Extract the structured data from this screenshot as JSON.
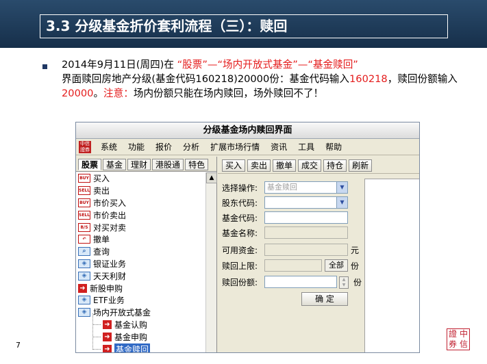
{
  "slide": {
    "title": "3.3 分级基金折价套利流程（三）：赎回",
    "page_number": "7",
    "text": {
      "part1": "2014年9月11日(周四)在 ",
      "red1": "“股票”—“场内开放式基金”—“基金赎回”",
      "part2": "界面赎回房地产分级(基金代码160218)20000份：基金代码输入",
      "red2": "160218",
      "part3": "，赎回份额输入",
      "red3": "20000",
      "part4": "。",
      "red4": "注意：",
      "part5": "场内份额只能在场内赎回，场外赎回不了！"
    },
    "logo": "中信證券"
  },
  "app": {
    "title": "分级基金场内赎回界面",
    "logo": "中信證券",
    "menu": [
      "系统",
      "功能",
      "报价",
      "分析",
      "扩展市场行情",
      "资讯",
      "工具",
      "帮助"
    ],
    "left_tabs": [
      "股票",
      "基金",
      "理财",
      "港股通",
      "特色"
    ],
    "tree": [
      {
        "icon": "BUY",
        "label": "买入"
      },
      {
        "icon": "SELL",
        "label": "卖出"
      },
      {
        "icon": "BUY",
        "label": "市价买入"
      },
      {
        "icon": "SELL",
        "label": "市价卖出"
      },
      {
        "icon": "B/S",
        "label": "对买对卖"
      },
      {
        "icon": "undo",
        "label": "撤单"
      },
      {
        "icon": "search",
        "label": "查询"
      },
      {
        "icon": "bank",
        "label": "银证业务"
      },
      {
        "icon": "bank",
        "label": "天天利财"
      },
      {
        "icon": "arrow",
        "label": "新股申购"
      },
      {
        "icon": "bank",
        "label": "ETF业务"
      },
      {
        "icon": "bank",
        "label": "场内开放式基金"
      }
    ],
    "tree_children": [
      "基金认购",
      "基金申购",
      "基金赎回"
    ],
    "toolbar": [
      "买入",
      "卖出",
      "撤单",
      "成交",
      "持仓",
      "刷新"
    ],
    "form": {
      "operation_label": "选择操作:",
      "operation_value": "基金赎回",
      "account_label": "股东代码:",
      "code_label": "基金代码:",
      "name_label": "基金名称:",
      "funds_label": "可用资金:",
      "funds_unit": "元",
      "limit_label": "赎回上限:",
      "all_button": "全部",
      "limit_unit": "份",
      "amount_label": "赎回份额:",
      "amount_unit": "份",
      "ok_button": "确 定"
    }
  }
}
